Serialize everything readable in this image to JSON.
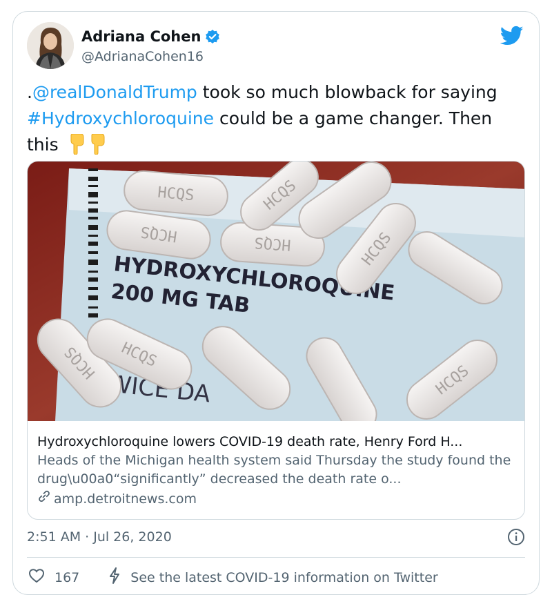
{
  "author": {
    "name": "Adriana Cohen",
    "handle": "@AdrianaCohen16"
  },
  "tweet": {
    "prefix": ".",
    "mention": "@realDonaldTrump",
    "text_part1": " took so much blowback for saying ",
    "hashtag": "#Hydroxychloroquine",
    "text_part2": " could be a game changer. Then this "
  },
  "link_card": {
    "image": {
      "pill_imprint": "HCQS",
      "label_line1": "HYDROXYCHLOROQUINE",
      "label_line2": "200 MG TAB",
      "label_line3": "WICE DA"
    },
    "title": "Hydroxychloroquine lowers COVID-19 death rate, Henry Ford H...",
    "description": "Heads of the Michigan health system said Thursday the study found the drug\\u00a0“significantly” decreased the death rate o...",
    "domain": "amp.detroitnews.com"
  },
  "timestamp": "2:51 AM · Jul 26, 2020",
  "actions": {
    "likes": "167",
    "covid_info": "See the latest COVID-19 information on Twitter"
  },
  "colors": {
    "link": "#1d9bf0",
    "secondary_text": "#536471",
    "border": "#cfd9de"
  }
}
